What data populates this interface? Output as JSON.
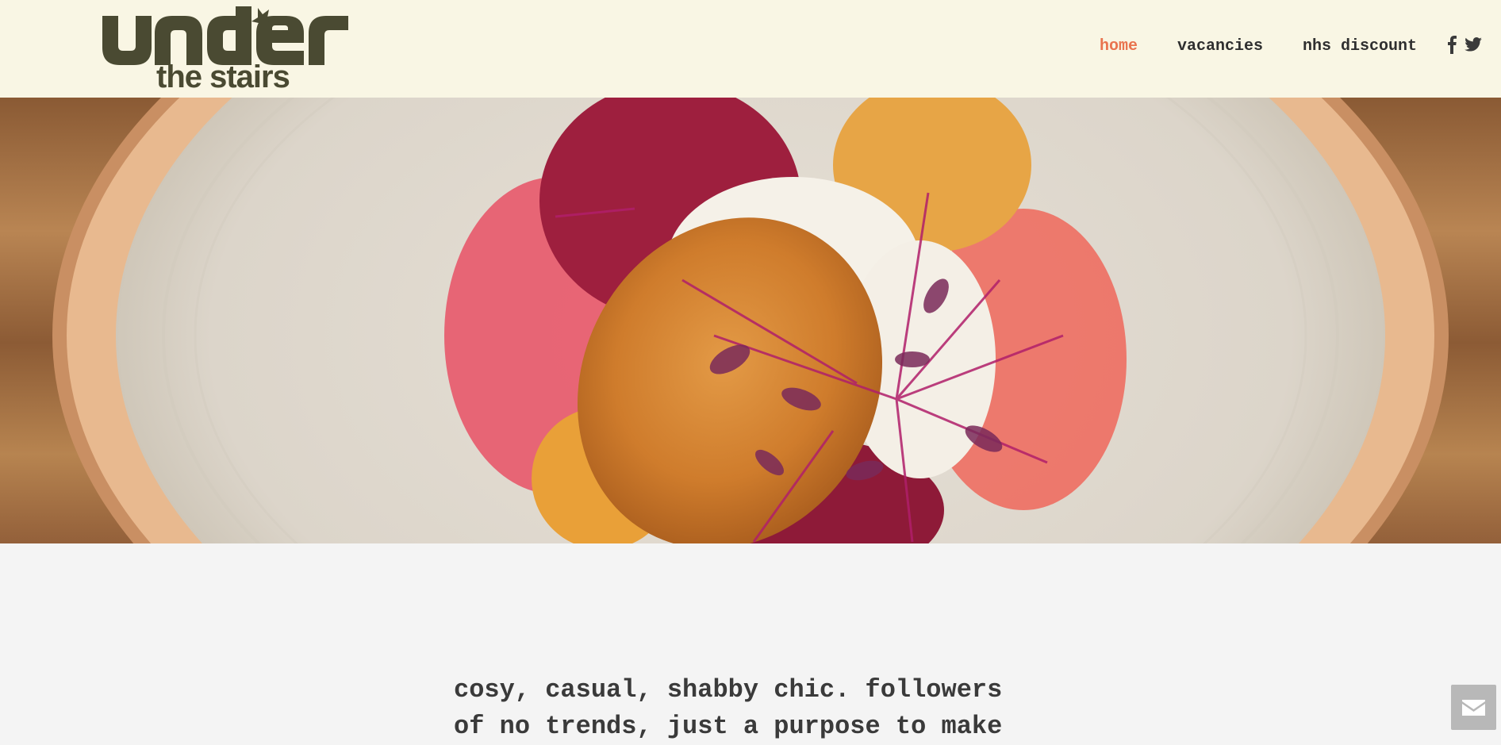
{
  "header": {
    "logo_text": "under the stairs",
    "nav": [
      {
        "label": "home",
        "active": true
      },
      {
        "label": "vacancies",
        "active": false
      },
      {
        "label": "nhs discount",
        "active": false
      }
    ],
    "social": [
      {
        "icon": "facebook-icon"
      },
      {
        "icon": "twitter-icon"
      }
    ]
  },
  "hero": {
    "image": "plated dish: fried croquette on beetroot slices with micro herbs"
  },
  "intro": {
    "text": "cosy, casual, shabby chic. followers\nof no trends, just a purpose to make"
  },
  "contact": {
    "icon": "envelope-icon"
  },
  "colors": {
    "header_bg": "#f9f6e4",
    "page_bg": "#f4f4f4",
    "nav_text": "#2f2f2f",
    "nav_active": "#e9744f",
    "logo": "#4a4a32",
    "body_text": "#3a3a3a",
    "contact_button": "#b8b8b8"
  }
}
